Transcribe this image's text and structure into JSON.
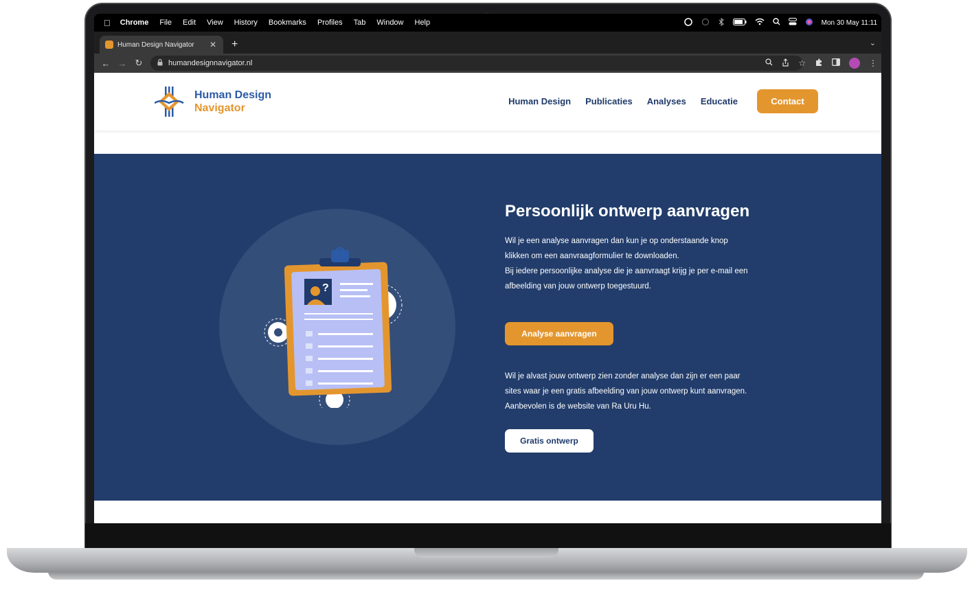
{
  "menubar": {
    "app": "Chrome",
    "items": [
      "File",
      "Edit",
      "View",
      "History",
      "Bookmarks",
      "Profiles",
      "Tab",
      "Window",
      "Help"
    ],
    "clock": "Mon 30 May  11:11"
  },
  "browser": {
    "tab_title": "Human Design Navigator",
    "url": "humandesignnavigator.nl"
  },
  "site": {
    "logo": {
      "line1": "Human Design",
      "line2": "Navigator"
    },
    "nav": [
      "Human Design",
      "Publicaties",
      "Analyses",
      "Educatie"
    ],
    "contact_label": "Contact",
    "hero": {
      "title": "Persoonlijk ontwerp aanvragen",
      "para1_line1": "Wil je een analyse aanvragen dan kun je op onderstaande knop",
      "para1_line2": "klikken om een aanvraagformulier te downloaden.",
      "para1_line3": "Bij iedere persoonlijke analyse die je aanvraagt krijg je per e-mail een",
      "para1_line4": "afbeelding van jouw ontwerp toegestuurd.",
      "analyse_button": "Analyse aanvragen",
      "para2_line1": "Wil je alvast jouw ontwerp zien zonder analyse dan zijn er een paar",
      "para2_line2": "sites waar je een gratis afbeelding van jouw ontwerp kunt aanvragen.",
      "para2_line3": "Aanbevolen is de website van Ra Uru Hu.",
      "gratis_button": "Gratis ontwerp"
    }
  },
  "colors": {
    "hero_bg": "#223d6b",
    "accent_orange": "#e4962e",
    "brand_blue": "#2b5aa6",
    "nav_text": "#1f3a6b"
  }
}
